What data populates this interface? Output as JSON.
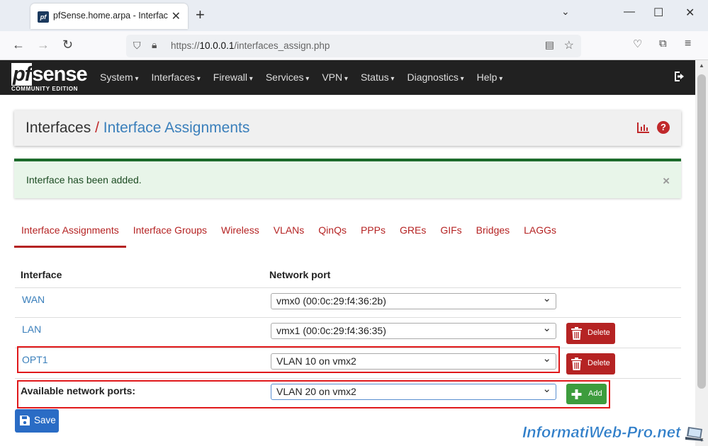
{
  "browser": {
    "tab_title": "pfSense.home.arpa - Interfaces: Interface Assignments",
    "tab_favicon_text": "pf",
    "url_prefix": "https://",
    "url_host": "10.0.0.1",
    "url_path": "/interfaces_assign.php"
  },
  "header": {
    "logo_main": "sense",
    "logo_pf": "pf",
    "logo_sub": "COMMUNITY EDITION",
    "menu": [
      "System",
      "Interfaces",
      "Firewall",
      "Services",
      "VPN",
      "Status",
      "Diagnostics",
      "Help"
    ]
  },
  "page": {
    "breadcrumb_root": "Interfaces",
    "breadcrumb_sep": "/",
    "breadcrumb_current": "Interface Assignments"
  },
  "alert": {
    "text": "Interface has been added.",
    "close": "×"
  },
  "tabs": [
    "Interface Assignments",
    "Interface Groups",
    "Wireless",
    "VLANs",
    "QinQs",
    "PPPs",
    "GREs",
    "GIFs",
    "Bridges",
    "LAGGs"
  ],
  "table": {
    "col_interface": "Interface",
    "col_port": "Network port",
    "rows": [
      {
        "name": "WAN",
        "port": "vmx0 (00:0c:29:f4:36:2b)"
      },
      {
        "name": "LAN",
        "port": "vmx1 (00:0c:29:f4:36:35)",
        "action": "Delete"
      },
      {
        "name": "OPT1",
        "port": "VLAN 10 on vmx2",
        "action": "Delete"
      }
    ],
    "available_label": "Available network ports:",
    "available_port": "VLAN 20 on vmx2",
    "add_label": "Add"
  },
  "save_label": "Save",
  "watermark": "InformatiWeb-Pro.net",
  "colors": {
    "accent_red": "#b52323",
    "link_blue": "#3a7fbb",
    "success_green": "#1c6b2b",
    "highlight_box": "#e0191b"
  }
}
